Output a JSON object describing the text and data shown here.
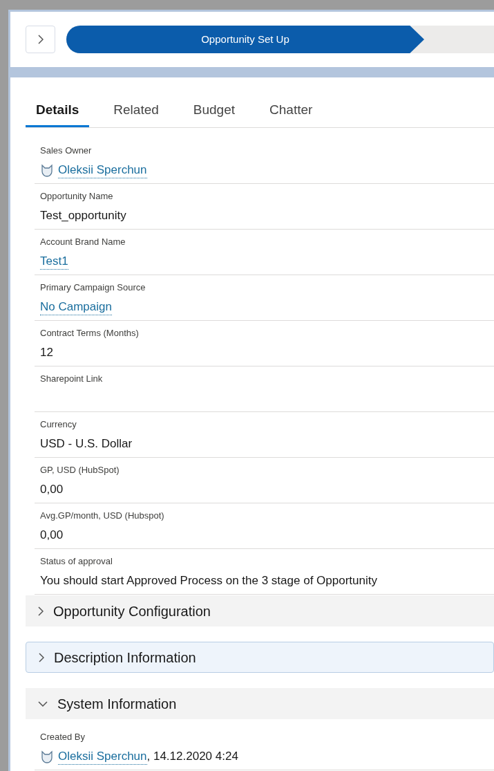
{
  "path": {
    "stages": [
      {
        "label": "Opportunity Set Up",
        "selected": true
      }
    ]
  },
  "tabs": [
    {
      "label": "Details",
      "selected": true
    },
    {
      "label": "Related",
      "selected": false
    },
    {
      "label": "Budget",
      "selected": false
    },
    {
      "label": "Chatter",
      "selected": false
    }
  ],
  "fields": [
    {
      "label": "Sales Owner",
      "kind": "user",
      "value": "Oleksii Sperchun"
    },
    {
      "label": "Opportunity Name",
      "kind": "text",
      "value": "Test_opportunity"
    },
    {
      "label": "Account Brand Name",
      "kind": "link",
      "value": "Test1"
    },
    {
      "label": "Primary Campaign Source",
      "kind": "link",
      "value": "No Campaign"
    },
    {
      "label": "Contract Terms (Months)",
      "kind": "text",
      "value": "12"
    },
    {
      "label": "Sharepoint Link",
      "kind": "empty"
    },
    {
      "label": "Currency",
      "kind": "text",
      "value": "USD - U.S. Dollar"
    },
    {
      "label": "GP, USD (HubSpot)",
      "kind": "text",
      "value": "0,00"
    },
    {
      "label": "Avg.GP/month, USD (Hubspot)",
      "kind": "text",
      "value": "0,00"
    },
    {
      "label": "Status of approval",
      "kind": "text",
      "value": "You should start Approved Process on the 3 stage of Opportunity"
    }
  ],
  "sections": [
    {
      "title": "Opportunity Configuration",
      "expanded": false,
      "focused": false
    },
    {
      "title": "Description Information",
      "expanded": false,
      "focused": true
    },
    {
      "title": "System Information",
      "expanded": true,
      "focused": false,
      "fields": [
        {
          "label": "Created By",
          "kind": "user",
          "value": "Oleksii Sperchun",
          "suffix": ", 14.12.2020 4:24"
        }
      ]
    }
  ]
}
